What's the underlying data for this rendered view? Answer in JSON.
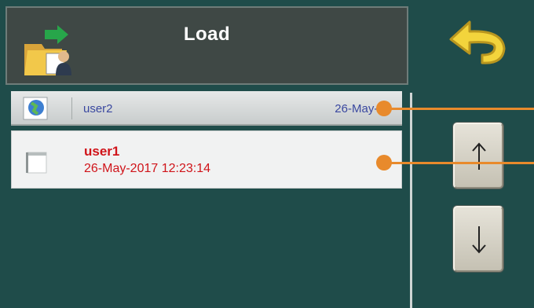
{
  "header": {
    "title": "Load",
    "icon": "load-folder-icon"
  },
  "back_button": {
    "icon": "back-arrow-icon"
  },
  "files": [
    {
      "name": "user2",
      "date": "26-May-20",
      "icon": "globe-file-icon"
    },
    {
      "name": "user1",
      "date": "26-May-2017 12:23:14",
      "icon": "file-icon"
    }
  ],
  "scroll": {
    "up_icon": "arrow-up-icon",
    "down_icon": "arrow-down-icon"
  },
  "colors": {
    "background": "#1f4c4a",
    "header": "#3f4845",
    "selected_text": "#d0141a",
    "list_text": "#3a48a0",
    "callout": "#e88a2c"
  }
}
